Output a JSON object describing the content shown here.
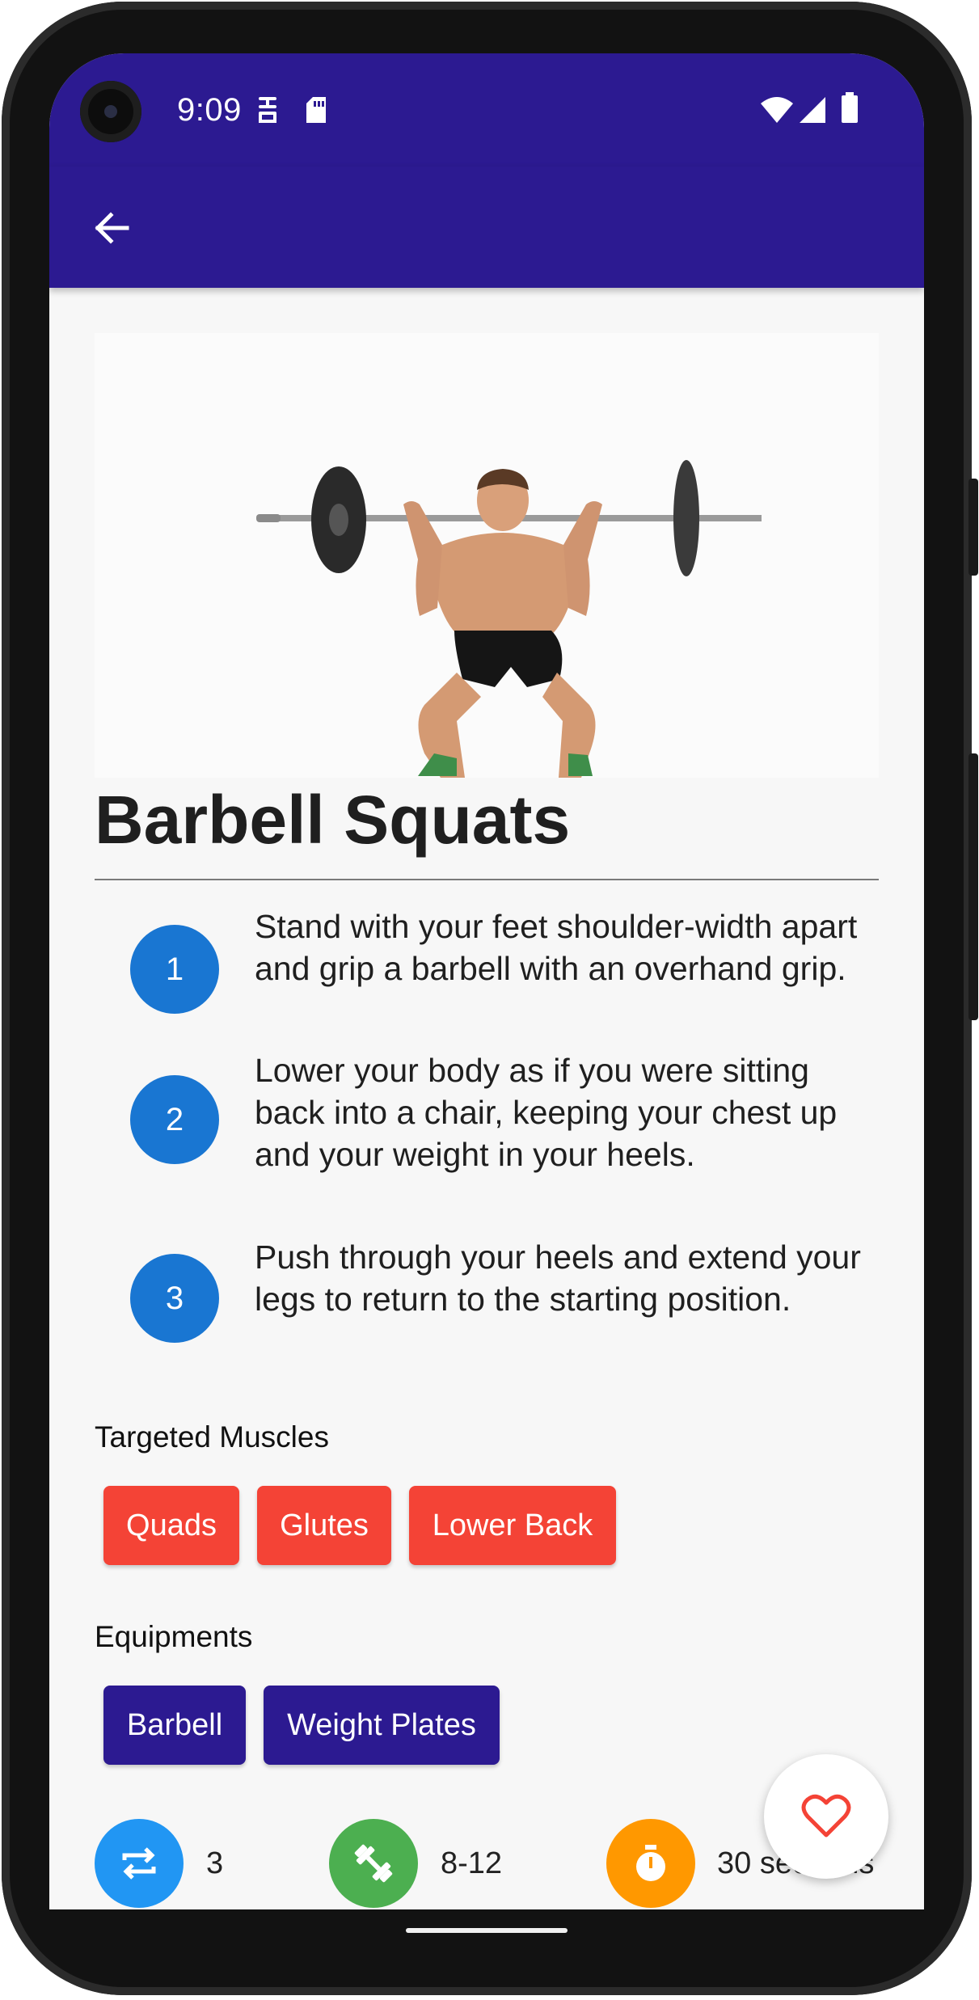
{
  "status_bar": {
    "time": "9:09",
    "icons": [
      "sim-icon",
      "sd-card-icon",
      "wifi-icon",
      "signal-icon",
      "battery-icon"
    ]
  },
  "app_bar": {
    "back_icon": "arrow-back-icon"
  },
  "exercise": {
    "title": "Barbell Squats",
    "image": "barbell-squat-illustration",
    "steps": [
      {
        "number": "1",
        "text": "Stand with your feet shoulder-width apart and grip a barbell with an overhand grip."
      },
      {
        "number": "2",
        "text": "Lower your body as if you were sitting back into a chair, keeping your chest up and your weight in your heels."
      },
      {
        "number": "3",
        "text": "Push through your heels and extend your legs to return to the starting position."
      }
    ],
    "targeted_muscles": {
      "label": "Targeted Muscles",
      "chips": [
        "Quads",
        "Glutes",
        "Lower Back"
      ]
    },
    "equipments": {
      "label": "Equipments",
      "chips": [
        "Barbell",
        "Weight Plates"
      ]
    },
    "stats": [
      {
        "icon": "repeat-icon",
        "value": "3",
        "color": "#2196f3"
      },
      {
        "icon": "dumbbell-icon",
        "value": "8-12",
        "color": "#4caf50"
      },
      {
        "icon": "timer-icon",
        "value": "30 seconds",
        "color": "#ff9800"
      }
    ]
  },
  "fab": {
    "icon": "heart-outline-icon",
    "color": "#f44336"
  },
  "colors": {
    "primary": "#2c1a91",
    "step_circle": "#1976d2",
    "muscle_chip": "#f44336",
    "equipment_chip": "#2c1a91"
  }
}
